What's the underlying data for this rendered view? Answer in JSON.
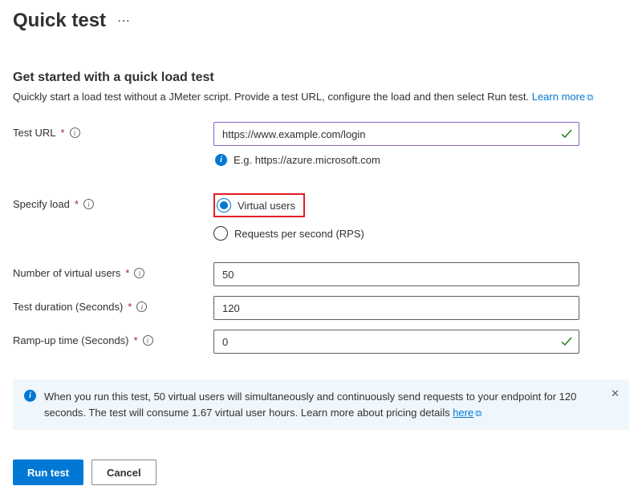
{
  "header": {
    "title": "Quick test"
  },
  "section": {
    "title": "Get started with a quick load test",
    "desc": "Quickly start a load test without a JMeter script. Provide a test URL, configure the load and then select Run test. ",
    "learn_more": "Learn more"
  },
  "fields": {
    "test_url": {
      "label": "Test URL",
      "value": "https://www.example.com/login",
      "hint": "E.g. https://azure.microsoft.com"
    },
    "specify_load": {
      "label": "Specify load",
      "options": {
        "virtual_users": "Virtual users",
        "rps": "Requests per second (RPS)"
      },
      "selected": "virtual_users"
    },
    "num_virtual_users": {
      "label": "Number of virtual users",
      "value": "50"
    },
    "test_duration": {
      "label": "Test duration (Seconds)",
      "value": "120"
    },
    "ramp_up": {
      "label": "Ramp-up time (Seconds)",
      "value": "0"
    }
  },
  "banner": {
    "text_before": "When you run this test, 50 virtual users will simultaneously and continuously send requests to your endpoint for 120 seconds. The test will consume 1.67 virtual user hours. Learn more about pricing details ",
    "link": "here"
  },
  "footer": {
    "run_test": "Run test",
    "cancel": "Cancel"
  }
}
